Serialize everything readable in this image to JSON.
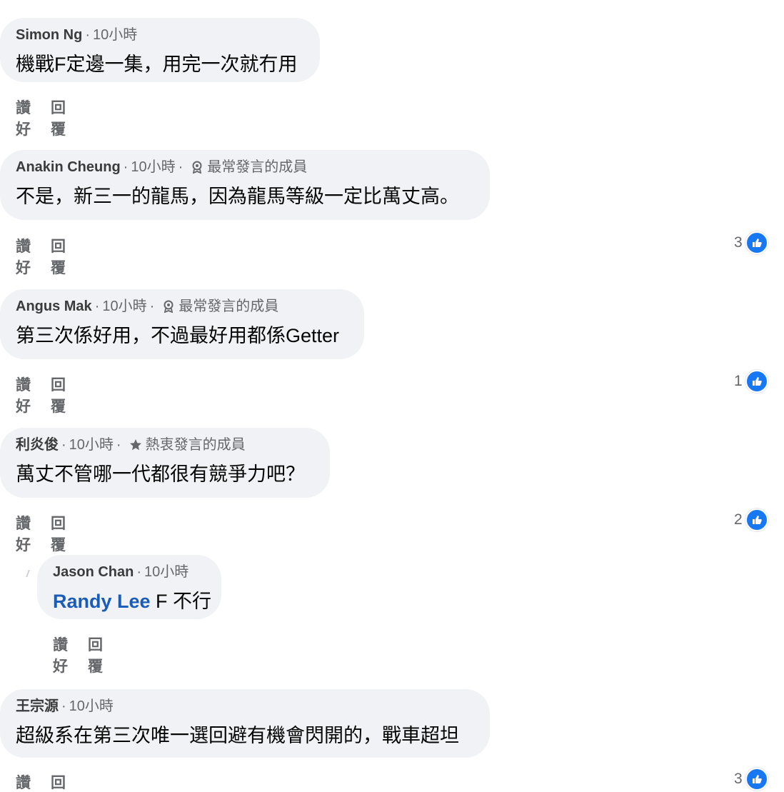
{
  "actions": {
    "like_label": "讚好",
    "reply_label": "回覆"
  },
  "icons": {
    "like": "thumbs-up-icon",
    "top_contributor": "award-badge-icon",
    "rising_contributor": "star-icon"
  },
  "colors": {
    "bubble_bg": "#f0f2f5",
    "like_blue": "#1877f2",
    "mention_blue": "#1a5cb8",
    "meta_gray": "#65676b"
  },
  "comments": [
    {
      "author": "Simon Ng",
      "time": "10小時",
      "badge": "",
      "text": "機戰F定邊一集，用完一次就冇用",
      "reaction_count": ""
    },
    {
      "author": "Anakin Cheung",
      "time": "10小時",
      "badge": "最常發言的成員",
      "text": "不是，新三一的龍馬，因為龍馬等級一定比萬丈高。",
      "reaction_count": "3"
    },
    {
      "author": "Angus Mak",
      "time": "10小時",
      "badge": "最常發言的成員",
      "text": "第三次係好用，不過最好用都係Getter",
      "reaction_count": "1"
    },
    {
      "author": "利炎俊",
      "time": "10小時",
      "badge": "熱衷發言的成員",
      "text": "萬丈不管哪一代都很有競爭力吧？",
      "reaction_count": "2"
    },
    {
      "author": "Jason Chan",
      "time": "10小時",
      "badge": "",
      "mention": "Randy Lee",
      "text": " F 不行",
      "reaction_count": ""
    },
    {
      "author": "王宗源",
      "time": "10小時",
      "badge": "",
      "text": "超級系在第三次唯一選回避有機會閃開的，戰車超坦",
      "reaction_count": "3"
    }
  ]
}
